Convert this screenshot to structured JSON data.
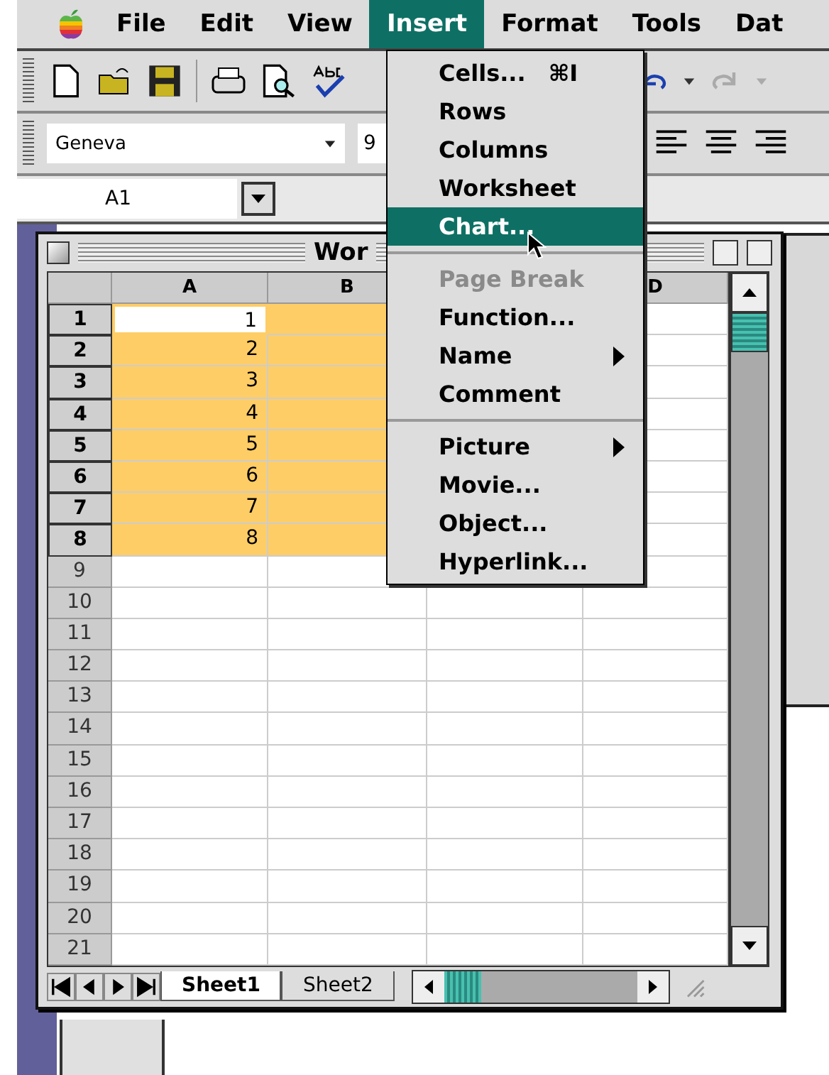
{
  "menu_bar": {
    "items": [
      {
        "label": "File",
        "selected": false
      },
      {
        "label": "Edit",
        "selected": false
      },
      {
        "label": "View",
        "selected": false
      },
      {
        "label": "Insert",
        "selected": true
      },
      {
        "label": "Format",
        "selected": false
      },
      {
        "label": "Tools",
        "selected": false
      },
      {
        "label": "Dat",
        "selected": false
      }
    ]
  },
  "format_bar": {
    "font": "Geneva",
    "size": "9"
  },
  "name_box": "A1",
  "workbook": {
    "title": "Wor",
    "columns": [
      {
        "label": "A"
      },
      {
        "label": "B"
      },
      {},
      {
        "label": "D"
      }
    ],
    "rows": [
      {
        "header": "1",
        "selected": true,
        "active": true,
        "value": "1"
      },
      {
        "header": "2",
        "selected": true,
        "active": false,
        "value": "2"
      },
      {
        "header": "3",
        "selected": true,
        "active": false,
        "value": "3"
      },
      {
        "header": "4",
        "selected": true,
        "active": false,
        "value": "4"
      },
      {
        "header": "5",
        "selected": true,
        "active": false,
        "value": "5"
      },
      {
        "header": "6",
        "selected": true,
        "active": false,
        "value": "6"
      },
      {
        "header": "7",
        "selected": true,
        "active": false,
        "value": "7"
      },
      {
        "header": "8",
        "selected": true,
        "active": false,
        "value": "8"
      },
      {
        "header": "9",
        "selected": false,
        "active": false
      },
      {
        "header": "10",
        "selected": false,
        "active": false
      },
      {
        "header": "11",
        "selected": false,
        "active": false
      },
      {
        "header": "12",
        "selected": false,
        "active": false
      },
      {
        "header": "13",
        "selected": false,
        "active": false
      },
      {
        "header": "14",
        "selected": false,
        "active": false
      },
      {
        "header": "15",
        "selected": false,
        "active": false
      },
      {
        "header": "16",
        "selected": false,
        "active": false
      },
      {
        "header": "17",
        "selected": false,
        "active": false
      },
      {
        "header": "18",
        "selected": false,
        "active": false
      },
      {
        "header": "19",
        "selected": false,
        "active": false
      },
      {
        "header": "20",
        "selected": false,
        "active": false
      },
      {
        "header": "21",
        "selected": false,
        "active": false
      }
    ],
    "sheet_tabs": [
      {
        "label": "Sheet1",
        "selected": true
      },
      {
        "label": "Sheet2",
        "selected": false
      }
    ]
  },
  "insert_menu": {
    "items": [
      {
        "kind": "item",
        "label": "Cells...",
        "shortcut": "⌘I",
        "selected": false,
        "disabled": false
      },
      {
        "kind": "item",
        "label": "Rows",
        "selected": false,
        "disabled": false
      },
      {
        "kind": "item",
        "label": "Columns",
        "selected": false,
        "disabled": false
      },
      {
        "kind": "item",
        "label": "Worksheet",
        "selected": false,
        "disabled": false
      },
      {
        "kind": "item",
        "label": "Chart...",
        "selected": true,
        "disabled": false
      },
      {
        "kind": "separator"
      },
      {
        "kind": "item",
        "label": "Page Break",
        "selected": false,
        "disabled": true
      },
      {
        "kind": "item",
        "label": "Function...",
        "selected": false,
        "disabled": false
      },
      {
        "kind": "item",
        "label": "Name",
        "selected": false,
        "disabled": false,
        "submenu": true
      },
      {
        "kind": "item",
        "label": "Comment",
        "selected": false,
        "disabled": false
      },
      {
        "kind": "separator"
      },
      {
        "kind": "item",
        "label": "Picture",
        "selected": false,
        "disabled": false,
        "submenu": true
      },
      {
        "kind": "item",
        "label": "Movie...",
        "selected": false,
        "disabled": false
      },
      {
        "kind": "item",
        "label": "Object...",
        "selected": false,
        "disabled": false
      },
      {
        "kind": "item",
        "label": "Hyperlink...",
        "selected": false,
        "disabled": false
      }
    ]
  }
}
